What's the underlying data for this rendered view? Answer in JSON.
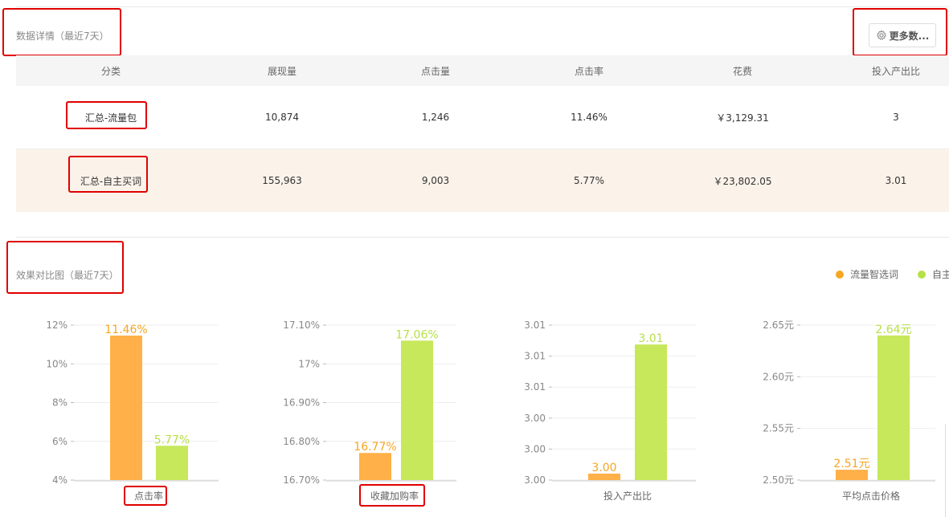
{
  "detail_section": {
    "title": "数据详情（最近7天）",
    "more_button_label": "更多数...",
    "more_icon": "gear-icon"
  },
  "table": {
    "columns": [
      "分类",
      "展现量",
      "点击量",
      "点击率",
      "花费",
      "投入产出比"
    ],
    "rows": [
      [
        "汇总-流量包",
        "10,874",
        "1,246",
        "11.46%",
        "￥3,129.31",
        "3"
      ],
      [
        "汇总-自主买词",
        "155,963",
        "9,003",
        "5.77%",
        "￥23,802.05",
        "3.01"
      ]
    ]
  },
  "compare_section": {
    "title": "效果对比图（最近7天）"
  },
  "legend": [
    {
      "label": "流量智选词",
      "color": "#f5a623"
    },
    {
      "label": "自主",
      "color": "#b8e04a"
    }
  ],
  "colors": {
    "orange": "#ffb048",
    "green": "#c6e85a",
    "orange_label": "#f5a623",
    "green_label": "#b8e04a",
    "highlight": "#e00000"
  },
  "chart_data": [
    {
      "type": "bar",
      "xlabel": "点击率",
      "categories": [
        "点击率"
      ],
      "yticks": [
        "4%",
        "6%",
        "8%",
        "10%",
        "12%"
      ],
      "ylim": [
        4,
        12
      ],
      "series": [
        {
          "values": [
            11.46
          ],
          "labels": [
            "11.46%"
          ]
        },
        {
          "values": [
            5.77
          ],
          "labels": [
            "5.77%"
          ]
        }
      ]
    },
    {
      "type": "bar",
      "xlabel": "收藏加购率",
      "categories": [
        "收藏加购率"
      ],
      "yticks": [
        "16.70%",
        "16.80%",
        "16.90%",
        "17%",
        "17.10%"
      ],
      "ylim": [
        16.7,
        17.1
      ],
      "series": [
        {
          "values": [
            16.77
          ],
          "labels": [
            "16.77%"
          ]
        },
        {
          "values": [
            17.06
          ],
          "labels": [
            "17.06%"
          ]
        }
      ]
    },
    {
      "type": "bar",
      "xlabel": "投入产出比",
      "categories": [
        "投入产出比"
      ],
      "yticks": [
        "3.00",
        "3.00",
        "3.00",
        "3.01",
        "3.01",
        "3.01"
      ],
      "ylim": [
        2.9995,
        3.0115
      ],
      "series": [
        {
          "values": [
            3.0
          ],
          "labels": [
            "3.00"
          ]
        },
        {
          "values": [
            3.01
          ],
          "labels": [
            "3.01"
          ]
        }
      ]
    },
    {
      "type": "bar",
      "xlabel": "平均点击价格",
      "categories": [
        "平均点击价格"
      ],
      "yticks": [
        "2.50元",
        "2.55元",
        "2.60元",
        "2.65元"
      ],
      "ylim": [
        2.5,
        2.65
      ],
      "series": [
        {
          "values": [
            2.51
          ],
          "labels": [
            "2.51元"
          ]
        },
        {
          "values": [
            2.64
          ],
          "labels": [
            "2.64元"
          ]
        }
      ]
    }
  ]
}
